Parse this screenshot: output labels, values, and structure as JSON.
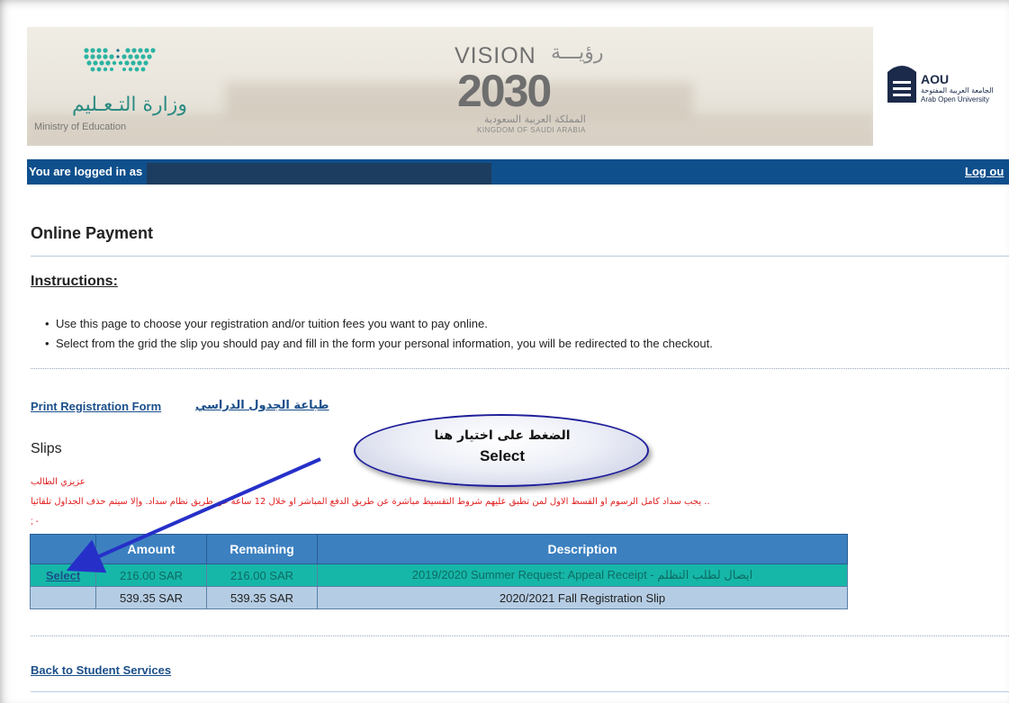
{
  "header": {
    "moe_ar": "وزارة التـعـليم",
    "moe_en": "Ministry of Education",
    "vision_word": "VISION",
    "vision_ar": "رؤيـــة",
    "vision_num": "2030",
    "vision_sub_ar": "المملكة العربية السعودية",
    "vision_sub_en": "KINGDOM OF SAUDI ARABIA",
    "aou_title": "AOU",
    "aou_ar": "الجامعة العربية المفتوحة",
    "aou_en": "Arab Open University"
  },
  "topbar": {
    "logged_in": "You are logged in as",
    "logout": "Log ou"
  },
  "page": {
    "title": "Online Payment",
    "instructions_title": "Instructions:",
    "instructions": [
      "Use this page to choose your registration and/or tuition fees you want to pay online.",
      "Select from the grid the slip you should pay and fill in the form your personal information, you will be redirected to the checkout."
    ],
    "print_en": "Print Registration Form",
    "print_ar": "طباعة الجدول الدراسي",
    "slips_label": "Slips",
    "notice_line1": "عزيزي الطالب",
    "notice_line2": ".. يجب سداد كامل الرسوم او القسط الاول لمن تطبق عليهم شروط التقسيط مباشرة عن طريق الدفع المباشر او خلال 12 ساعة عن طريق نظام سداد. وإلا سيتم حذف الجداول تلقائيا",
    "notice_line3": "; -",
    "back_link": "Back to Student Services"
  },
  "table": {
    "headers": [
      "",
      "Amount",
      "Remaining",
      "Description"
    ],
    "rows": [
      {
        "select": "Select",
        "amount": "216.00 SAR",
        "remaining": "216.00 SAR",
        "description": "2019/2020 Summer Request: Appeal Receipt - ايصال لطلب التظلم"
      },
      {
        "select": "",
        "amount": "539.35 SAR",
        "remaining": "539.35 SAR",
        "description": "2020/2021 Fall Registration Slip"
      }
    ]
  },
  "callout": {
    "ar": "الضغط على اختيار هنا",
    "en": "Select"
  },
  "colors": {
    "topbar": "#0f4f8c",
    "table_header": "#3c80c0",
    "selected_row": "#16b7a8",
    "alt_row": "#b5cde4",
    "notice": "#e02020",
    "arrow": "#2630c8"
  }
}
